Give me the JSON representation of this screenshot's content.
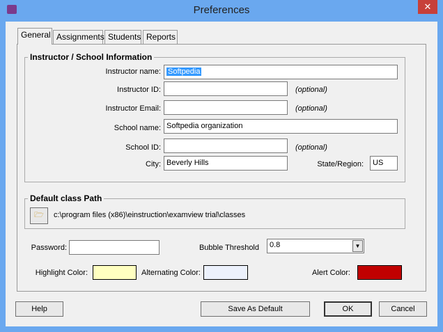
{
  "window": {
    "title": "Preferences",
    "close": "✕"
  },
  "tabs": [
    {
      "label": "General"
    },
    {
      "label": "Assignments"
    },
    {
      "label": "Students"
    },
    {
      "label": "Reports"
    }
  ],
  "instructor": {
    "title": "Instructor / School Information",
    "name_label": "Instructor name:",
    "name": "Softpedia",
    "id_label": "Instructor ID:",
    "id": "",
    "optional": "(optional)",
    "email_label": "Instructor Email:",
    "email": "",
    "school_label": "School name:",
    "school": "Softpedia organization",
    "school_id_label": "School ID:",
    "school_id": "",
    "city_label": "City:",
    "city": "Beverly Hills",
    "state_label": "State/Region:",
    "state": "US"
  },
  "path": {
    "title": "Default class Path",
    "value": "c:\\program files (x86)\\einstruction\\examview trial\\classes"
  },
  "password_label": "Password:",
  "password": "",
  "bubble": {
    "label": "Bubble Threshold",
    "value": "0.8"
  },
  "colors": {
    "highlight_label": "Highlight Color:",
    "highlight": "#ffffc0",
    "alternating_label": "Alternating Color:",
    "alternating": "#ecf1fc",
    "alert_label": "Alert Color:",
    "alert": "#c00000"
  },
  "buttons": {
    "help": "Help",
    "save_default": "Save As Default",
    "ok": "OK",
    "cancel": "Cancel"
  }
}
